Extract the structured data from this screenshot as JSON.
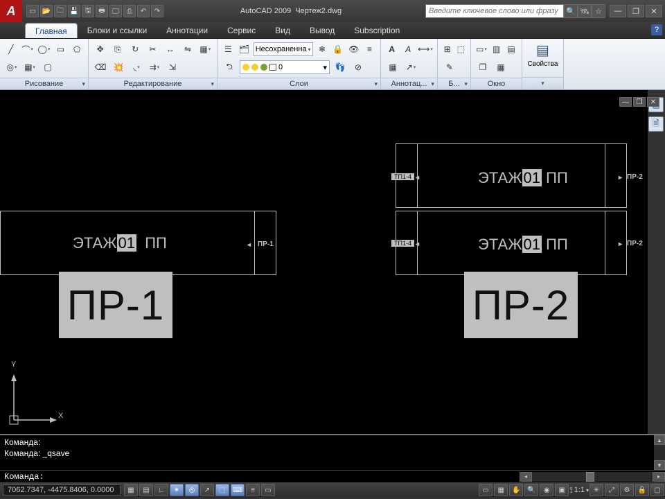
{
  "titlebar": {
    "app_name": "AutoCAD 2009",
    "doc_name": "Чертеж2.dwg",
    "search_placeholder": "Введите ключевое слово или фразу"
  },
  "tabs": {
    "items": [
      "Главная",
      "Блоки и ссылки",
      "Аннотации",
      "Сервис",
      "Вид",
      "Вывод",
      "Subscription"
    ],
    "active_index": 0
  },
  "ribbon": {
    "draw_title": "Рисование",
    "edit_title": "Редактирование",
    "layers_title": "Слои",
    "annot_title": "Аннотац...",
    "block_title": "Б...",
    "window_title": "Окно",
    "props_label": "Свойства",
    "layer_state": "Несохраненна",
    "current_layer": "0"
  },
  "drawing": {
    "etazh_prefix": "ЭТАЖ",
    "etazh_num": "01",
    "pp": "ПП",
    "pr1_tag": "ПР-1",
    "pr2_tag": "ПР-2",
    "pr1_big": "ПР-1",
    "pr2_big": "ПР-2",
    "tag_tp": "ТП1-4"
  },
  "command": {
    "line1": "Команда:",
    "line2": "Команда: _qsave",
    "prompt": "Команда:"
  },
  "status": {
    "coords": "7062.7347, -4475.8406, 0.0000",
    "scale": "1:1"
  }
}
